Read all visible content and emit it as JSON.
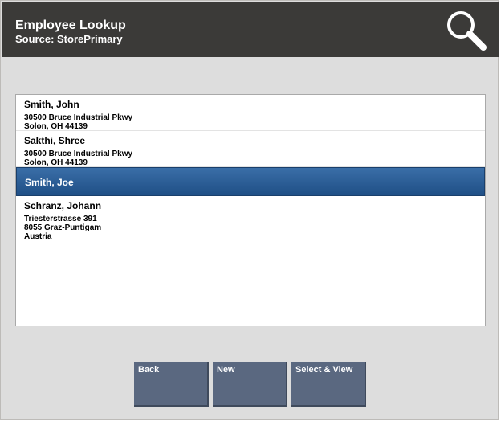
{
  "header": {
    "title": "Employee Lookup",
    "subtitle": "Source: StorePrimary",
    "icon": "search-icon"
  },
  "employees": [
    {
      "name": "Smith, John",
      "address": [
        "30500 Bruce Industrial Pkwy",
        "Solon, OH 44139"
      ],
      "selected": false
    },
    {
      "name": "Sakthi, Shree",
      "address": [
        "30500 Bruce Industrial Pkwy",
        "Solon, OH 44139"
      ],
      "selected": false
    },
    {
      "name": "Smith, Joe",
      "address": [],
      "selected": true
    },
    {
      "name": "Schranz, Johann",
      "address": [
        "Triesterstrasse 391",
        "8055 Graz-Puntigam",
        "Austria"
      ],
      "selected": false
    }
  ],
  "buttons": {
    "back": "Back",
    "new": "New",
    "select_view": "Select & View"
  },
  "colors": {
    "header_bg": "#3b3a38",
    "page_bg": "#dddddd",
    "selected_row": "#2a5d97",
    "button_bg": "#5a6880"
  }
}
